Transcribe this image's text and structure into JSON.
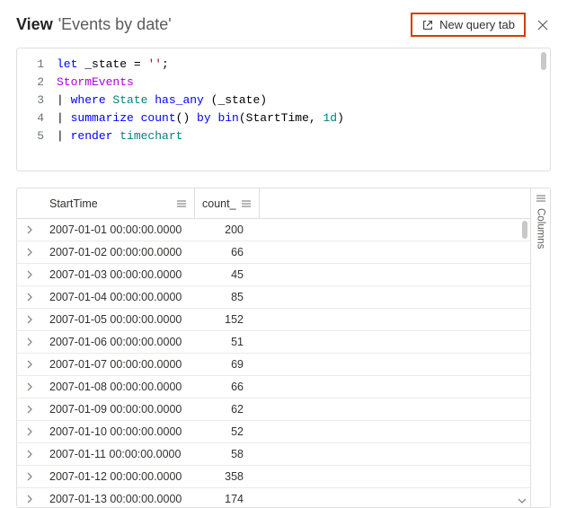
{
  "header": {
    "view_label": "View",
    "query_name": "'Events by date'",
    "new_query_label": "New query tab"
  },
  "code_lines": [
    {
      "n": 1,
      "tokens": [
        [
          "let ",
          "blue"
        ],
        [
          "_state ",
          "black"
        ],
        [
          "= ",
          "black"
        ],
        [
          "''",
          "red"
        ],
        [
          ";",
          "black"
        ]
      ]
    },
    {
      "n": 2,
      "tokens": [
        [
          "StormEvents",
          "purple"
        ]
      ]
    },
    {
      "n": 3,
      "tokens": [
        [
          "| ",
          "black"
        ],
        [
          "where ",
          "blue"
        ],
        [
          "State ",
          "teal"
        ],
        [
          "has_any ",
          "blue"
        ],
        [
          "(_state)",
          "black"
        ]
      ]
    },
    {
      "n": 4,
      "tokens": [
        [
          "| ",
          "black"
        ],
        [
          "summarize ",
          "blue"
        ],
        [
          "count",
          "blue"
        ],
        [
          "() ",
          "black"
        ],
        [
          "by ",
          "blue"
        ],
        [
          "bin",
          "blue"
        ],
        [
          "(StartTime, ",
          "black"
        ],
        [
          "1d",
          "teal"
        ],
        [
          ")",
          "black"
        ]
      ]
    },
    {
      "n": 5,
      "tokens": [
        [
          "| ",
          "black"
        ],
        [
          "render ",
          "blue"
        ],
        [
          "timechart",
          "teal"
        ]
      ]
    }
  ],
  "columns": {
    "start": "StartTime",
    "count": "count_"
  },
  "side_label": "Columns",
  "rows": [
    {
      "t": "2007-01-01 00:00:00.0000",
      "c": "200"
    },
    {
      "t": "2007-01-02 00:00:00.0000",
      "c": "66"
    },
    {
      "t": "2007-01-03 00:00:00.0000",
      "c": "45"
    },
    {
      "t": "2007-01-04 00:00:00.0000",
      "c": "85"
    },
    {
      "t": "2007-01-05 00:00:00.0000",
      "c": "152"
    },
    {
      "t": "2007-01-06 00:00:00.0000",
      "c": "51"
    },
    {
      "t": "2007-01-07 00:00:00.0000",
      "c": "69"
    },
    {
      "t": "2007-01-08 00:00:00.0000",
      "c": "66"
    },
    {
      "t": "2007-01-09 00:00:00.0000",
      "c": "62"
    },
    {
      "t": "2007-01-10 00:00:00.0000",
      "c": "52"
    },
    {
      "t": "2007-01-11 00:00:00.0000",
      "c": "58"
    },
    {
      "t": "2007-01-12 00:00:00.0000",
      "c": "358"
    },
    {
      "t": "2007-01-13 00:00:00.0000",
      "c": "174"
    }
  ]
}
